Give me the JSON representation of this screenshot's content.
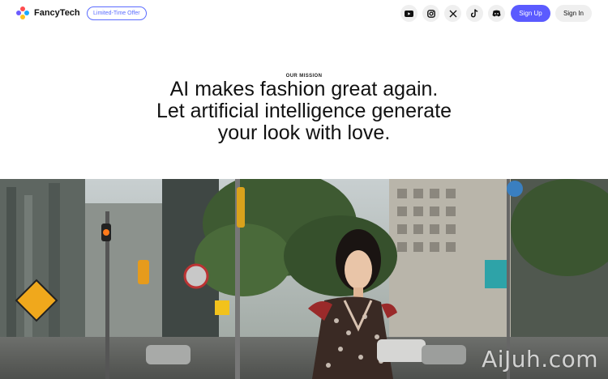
{
  "header": {
    "brand_name": "FancyTech",
    "offer_label": "Limited-Time Offer",
    "social_icons": [
      "youtube-icon",
      "instagram-icon",
      "x-icon",
      "tiktok-icon",
      "discord-icon"
    ],
    "signup_label": "Sign Up",
    "signin_label": "Sign In",
    "accent_color": "#5b5bff"
  },
  "mission": {
    "label": "OUR MISSION",
    "line1": "AI makes fashion great again.",
    "line2": "Let artificial intelligence generate",
    "line3": "your look with love."
  },
  "hero": {
    "watermark": "AiJuh.com"
  }
}
